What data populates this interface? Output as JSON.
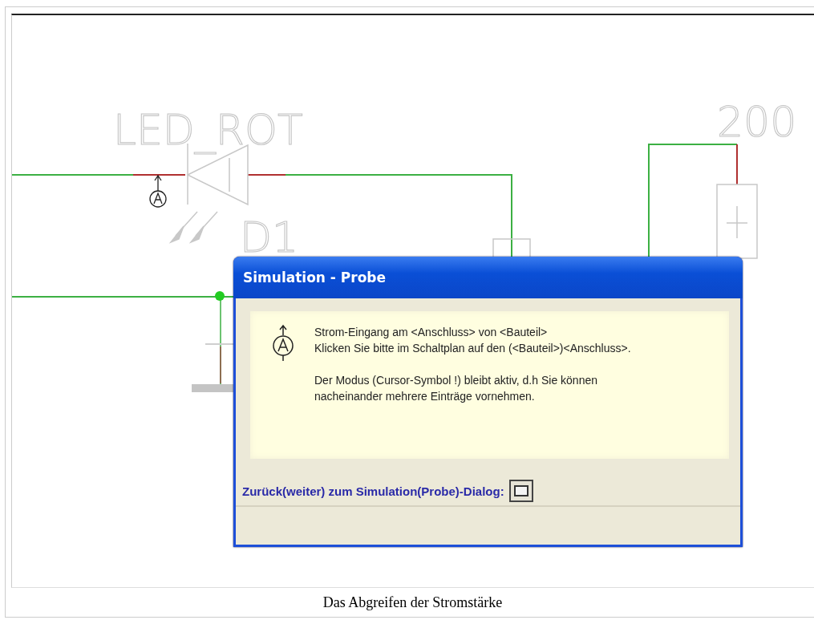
{
  "schematic": {
    "component_name": "LED_ROT",
    "designator": "D1",
    "value": "200"
  },
  "dialog": {
    "title": "Simulation - Probe",
    "paragraphs": [
      [
        "Strom-Eingang am <Anschluss> von <Bauteil>",
        "Klicken Sie bitte im Schaltplan auf den (<Bauteil>)<Anschluss>."
      ],
      [
        "Der Modus (Cursor-Symbol !) bleibt aktiv, d.h Sie können",
        "nacheinander mehrere Einträge vornehmen."
      ]
    ],
    "footer_link": "Zurück(weiter) zum Simulation(Probe)-Dialog:"
  },
  "caption": "Das Abgreifen der Stromstärke"
}
